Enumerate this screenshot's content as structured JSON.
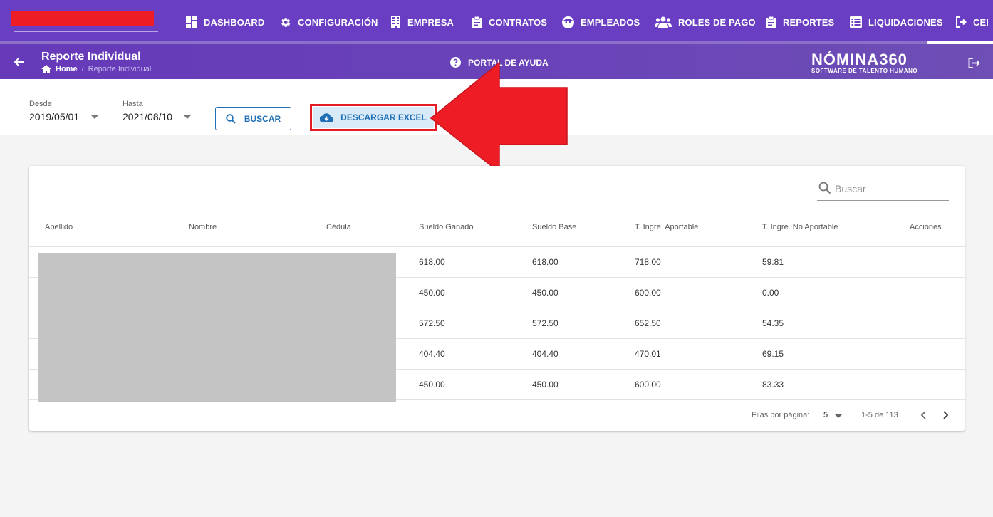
{
  "nav": {
    "items": [
      {
        "label": "DASHBOARD",
        "icon": "dashboard-icon"
      },
      {
        "label": "CONFIGURACIÓN",
        "icon": "gear-icon"
      },
      {
        "label": "EMPRESA",
        "icon": "building-icon"
      },
      {
        "label": "CONTRATOS",
        "icon": "clipboard-icon"
      },
      {
        "label": "EMPLEADOS",
        "icon": "face-icon"
      },
      {
        "label": "ROLES DE PAGO",
        "icon": "users-icon"
      },
      {
        "label": "REPORTES",
        "icon": "clipboard-icon"
      },
      {
        "label": "LIQUIDACIONES",
        "icon": "list-icon"
      },
      {
        "label": "CEI",
        "icon": "exit-icon"
      }
    ]
  },
  "header": {
    "title": "Reporte Individual",
    "breadcrumb": {
      "home": "Home",
      "current": "Reporte Individual"
    },
    "help_label": "PORTAL DE AYUDA",
    "brand_main": "NÓMINA360",
    "brand_sub": "SOFTWARE DE TALENTO HUMANO"
  },
  "filters": {
    "from_label": "Desde",
    "from_value": "2019/05/01",
    "to_label": "Hasta",
    "to_value": "2021/08/10",
    "search_button": "BUSCAR",
    "excel_button": "DESCARGAR EXCEL"
  },
  "table": {
    "search_placeholder": "Buscar",
    "columns": [
      "Apellido",
      "Nombre",
      "Cédula",
      "Sueldo Ganado",
      "Sueldo Base",
      "T. Ingre. Aportable",
      "T. Ingre. No Aportable",
      "Acciones"
    ],
    "rows": [
      {
        "sueldo_ganado": "618.00",
        "sueldo_base": "618.00",
        "aportable": "718.00",
        "no_aportable": "59.81"
      },
      {
        "sueldo_ganado": "450.00",
        "sueldo_base": "450.00",
        "aportable": "600.00",
        "no_aportable": "0.00"
      },
      {
        "sueldo_ganado": "572.50",
        "sueldo_base": "572.50",
        "aportable": "652.50",
        "no_aportable": "54.35"
      },
      {
        "sueldo_ganado": "404.40",
        "sueldo_base": "404.40",
        "aportable": "470.01",
        "no_aportable": "69.15"
      },
      {
        "sueldo_ganado": "450.00",
        "sueldo_base": "450.00",
        "aportable": "600.00",
        "no_aportable": "83.33"
      }
    ],
    "rows_per_page_label": "Filas por página:",
    "rows_per_page": "5",
    "range": "1-5 de 113"
  },
  "colors": {
    "primary": "#6a3ec2",
    "accent": "#1e6fb5",
    "highlight": "#e21b24"
  }
}
